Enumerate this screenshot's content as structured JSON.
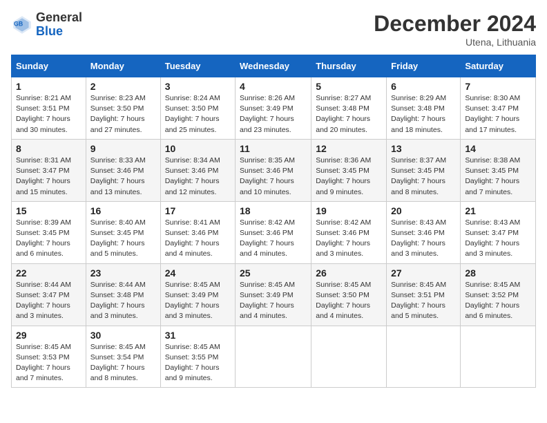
{
  "header": {
    "logo_general": "General",
    "logo_blue": "Blue",
    "month_title": "December 2024",
    "location": "Utena, Lithuania"
  },
  "days_of_week": [
    "Sunday",
    "Monday",
    "Tuesday",
    "Wednesday",
    "Thursday",
    "Friday",
    "Saturday"
  ],
  "weeks": [
    [
      {
        "day": "1",
        "info": "Sunrise: 8:21 AM\nSunset: 3:51 PM\nDaylight: 7 hours\nand 30 minutes."
      },
      {
        "day": "2",
        "info": "Sunrise: 8:23 AM\nSunset: 3:50 PM\nDaylight: 7 hours\nand 27 minutes."
      },
      {
        "day": "3",
        "info": "Sunrise: 8:24 AM\nSunset: 3:50 PM\nDaylight: 7 hours\nand 25 minutes."
      },
      {
        "day": "4",
        "info": "Sunrise: 8:26 AM\nSunset: 3:49 PM\nDaylight: 7 hours\nand 23 minutes."
      },
      {
        "day": "5",
        "info": "Sunrise: 8:27 AM\nSunset: 3:48 PM\nDaylight: 7 hours\nand 20 minutes."
      },
      {
        "day": "6",
        "info": "Sunrise: 8:29 AM\nSunset: 3:48 PM\nDaylight: 7 hours\nand 18 minutes."
      },
      {
        "day": "7",
        "info": "Sunrise: 8:30 AM\nSunset: 3:47 PM\nDaylight: 7 hours\nand 17 minutes."
      }
    ],
    [
      {
        "day": "8",
        "info": "Sunrise: 8:31 AM\nSunset: 3:47 PM\nDaylight: 7 hours\nand 15 minutes."
      },
      {
        "day": "9",
        "info": "Sunrise: 8:33 AM\nSunset: 3:46 PM\nDaylight: 7 hours\nand 13 minutes."
      },
      {
        "day": "10",
        "info": "Sunrise: 8:34 AM\nSunset: 3:46 PM\nDaylight: 7 hours\nand 12 minutes."
      },
      {
        "day": "11",
        "info": "Sunrise: 8:35 AM\nSunset: 3:46 PM\nDaylight: 7 hours\nand 10 minutes."
      },
      {
        "day": "12",
        "info": "Sunrise: 8:36 AM\nSunset: 3:45 PM\nDaylight: 7 hours\nand 9 minutes."
      },
      {
        "day": "13",
        "info": "Sunrise: 8:37 AM\nSunset: 3:45 PM\nDaylight: 7 hours\nand 8 minutes."
      },
      {
        "day": "14",
        "info": "Sunrise: 8:38 AM\nSunset: 3:45 PM\nDaylight: 7 hours\nand 7 minutes."
      }
    ],
    [
      {
        "day": "15",
        "info": "Sunrise: 8:39 AM\nSunset: 3:45 PM\nDaylight: 7 hours\nand 6 minutes."
      },
      {
        "day": "16",
        "info": "Sunrise: 8:40 AM\nSunset: 3:45 PM\nDaylight: 7 hours\nand 5 minutes."
      },
      {
        "day": "17",
        "info": "Sunrise: 8:41 AM\nSunset: 3:46 PM\nDaylight: 7 hours\nand 4 minutes."
      },
      {
        "day": "18",
        "info": "Sunrise: 8:42 AM\nSunset: 3:46 PM\nDaylight: 7 hours\nand 4 minutes."
      },
      {
        "day": "19",
        "info": "Sunrise: 8:42 AM\nSunset: 3:46 PM\nDaylight: 7 hours\nand 3 minutes."
      },
      {
        "day": "20",
        "info": "Sunrise: 8:43 AM\nSunset: 3:46 PM\nDaylight: 7 hours\nand 3 minutes."
      },
      {
        "day": "21",
        "info": "Sunrise: 8:43 AM\nSunset: 3:47 PM\nDaylight: 7 hours\nand 3 minutes."
      }
    ],
    [
      {
        "day": "22",
        "info": "Sunrise: 8:44 AM\nSunset: 3:47 PM\nDaylight: 7 hours\nand 3 minutes."
      },
      {
        "day": "23",
        "info": "Sunrise: 8:44 AM\nSunset: 3:48 PM\nDaylight: 7 hours\nand 3 minutes."
      },
      {
        "day": "24",
        "info": "Sunrise: 8:45 AM\nSunset: 3:49 PM\nDaylight: 7 hours\nand 3 minutes."
      },
      {
        "day": "25",
        "info": "Sunrise: 8:45 AM\nSunset: 3:49 PM\nDaylight: 7 hours\nand 4 minutes."
      },
      {
        "day": "26",
        "info": "Sunrise: 8:45 AM\nSunset: 3:50 PM\nDaylight: 7 hours\nand 4 minutes."
      },
      {
        "day": "27",
        "info": "Sunrise: 8:45 AM\nSunset: 3:51 PM\nDaylight: 7 hours\nand 5 minutes."
      },
      {
        "day": "28",
        "info": "Sunrise: 8:45 AM\nSunset: 3:52 PM\nDaylight: 7 hours\nand 6 minutes."
      }
    ],
    [
      {
        "day": "29",
        "info": "Sunrise: 8:45 AM\nSunset: 3:53 PM\nDaylight: 7 hours\nand 7 minutes."
      },
      {
        "day": "30",
        "info": "Sunrise: 8:45 AM\nSunset: 3:54 PM\nDaylight: 7 hours\nand 8 minutes."
      },
      {
        "day": "31",
        "info": "Sunrise: 8:45 AM\nSunset: 3:55 PM\nDaylight: 7 hours\nand 9 minutes."
      },
      null,
      null,
      null,
      null
    ]
  ]
}
